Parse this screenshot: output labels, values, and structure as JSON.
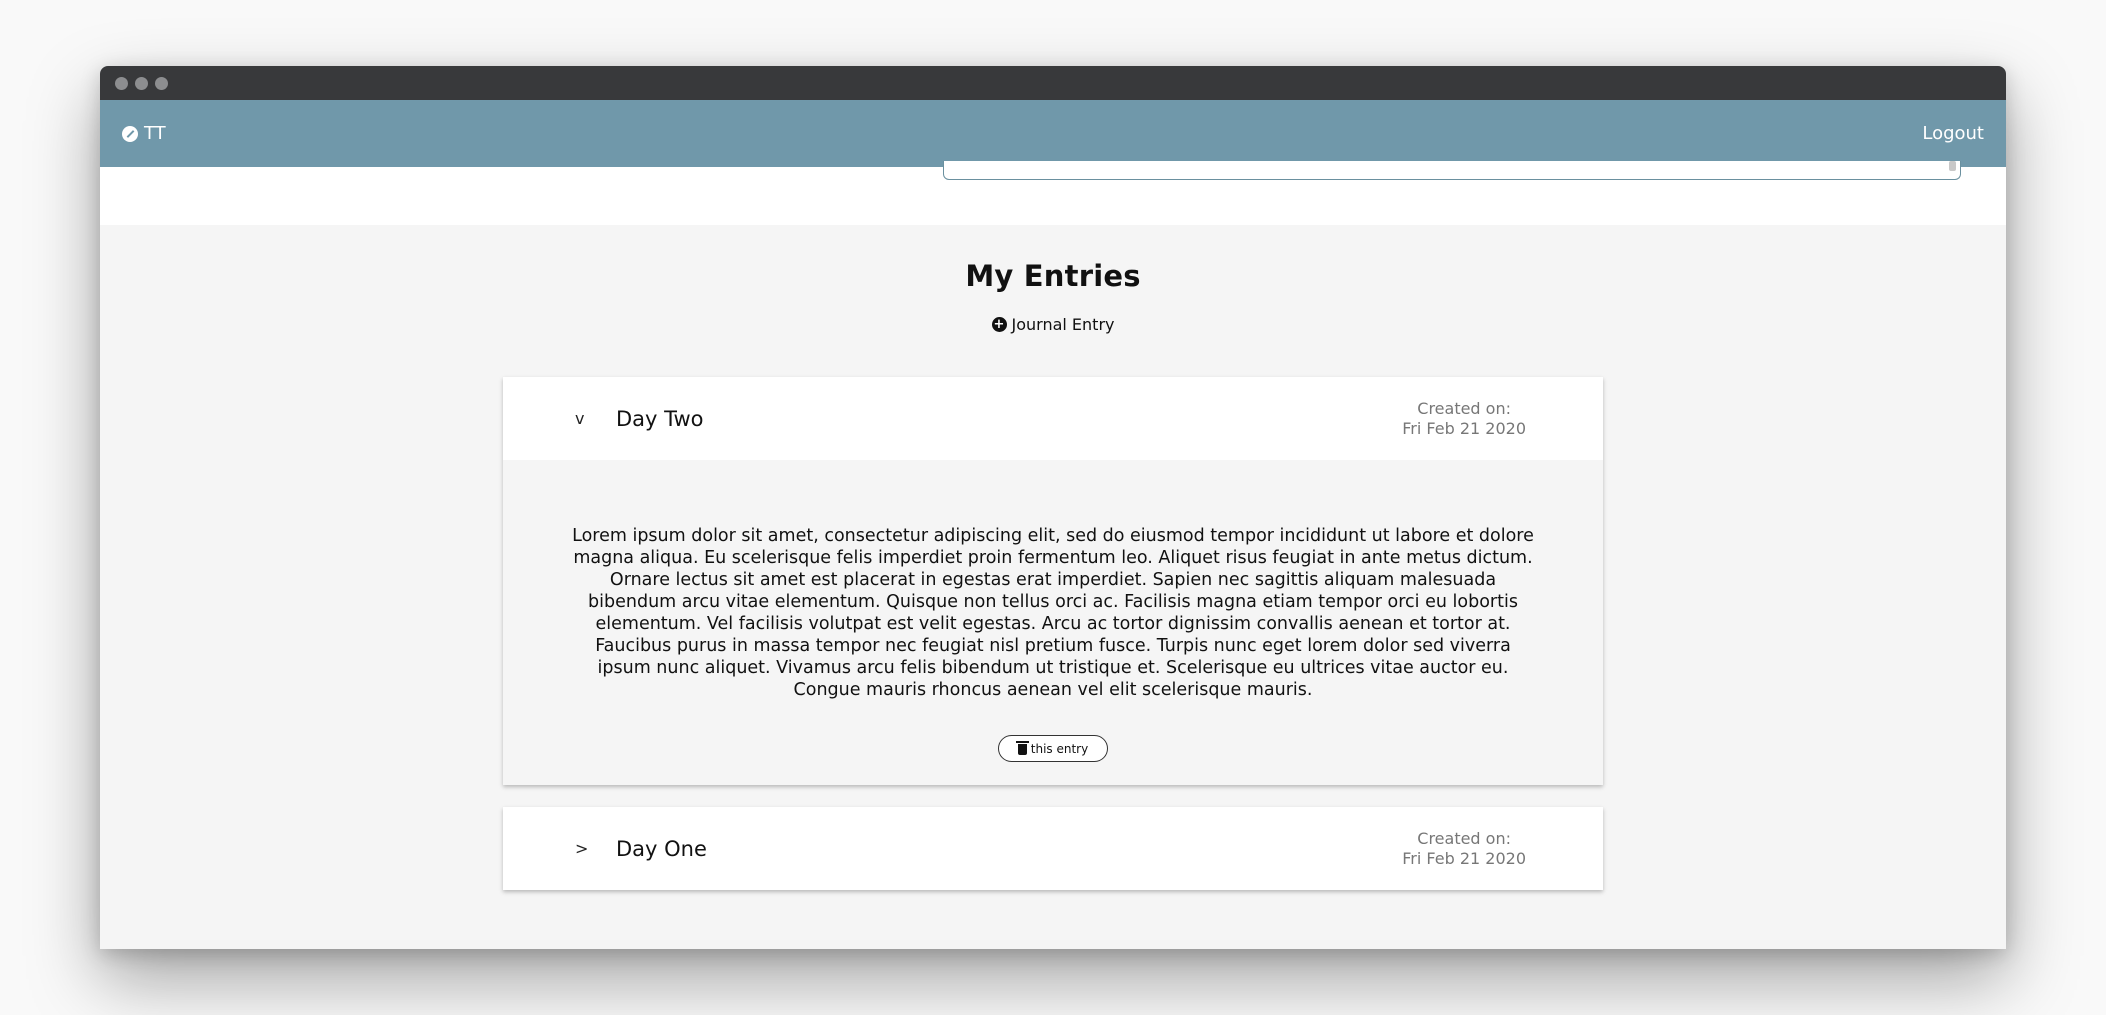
{
  "navbar": {
    "brand": "TT",
    "logout": "Logout"
  },
  "main": {
    "title": "My Entries",
    "add_entry": "Journal Entry"
  },
  "entries": [
    {
      "expanded_chevron": "v",
      "title": "Day Two",
      "created_label": "Created on:",
      "created_date": "Fri Feb 21 2020",
      "body": "Lorem ipsum dolor sit amet, consectetur adipiscing elit, sed do eiusmod tempor incididunt ut labore et dolore magna aliqua. Eu scelerisque felis imperdiet proin fermentum leo. Aliquet risus feugiat in ante metus dictum. Ornare lectus sit amet est placerat in egestas erat imperdiet. Sapien nec sagittis aliquam malesuada bibendum arcu vitae elementum. Quisque non tellus orci ac. Facilisis magna etiam tempor orci eu lobortis elementum. Vel facilisis volutpat est velit egestas. Arcu ac tortor dignissim convallis aenean et tortor at. Faucibus purus in massa tempor nec feugiat nisl pretium fusce. Turpis nunc eget lorem dolor sed viverra ipsum nunc aliquet. Vivamus arcu felis bibendum ut tristique et. Scelerisque eu ultrices vitae auctor eu. Congue mauris rhoncus aenean vel elit scelerisque mauris.",
      "delete_label": "this entry"
    },
    {
      "collapsed_chevron": ">",
      "title": "Day One",
      "created_label": "Created on:",
      "created_date": "Fri Feb 21 2020"
    }
  ]
}
